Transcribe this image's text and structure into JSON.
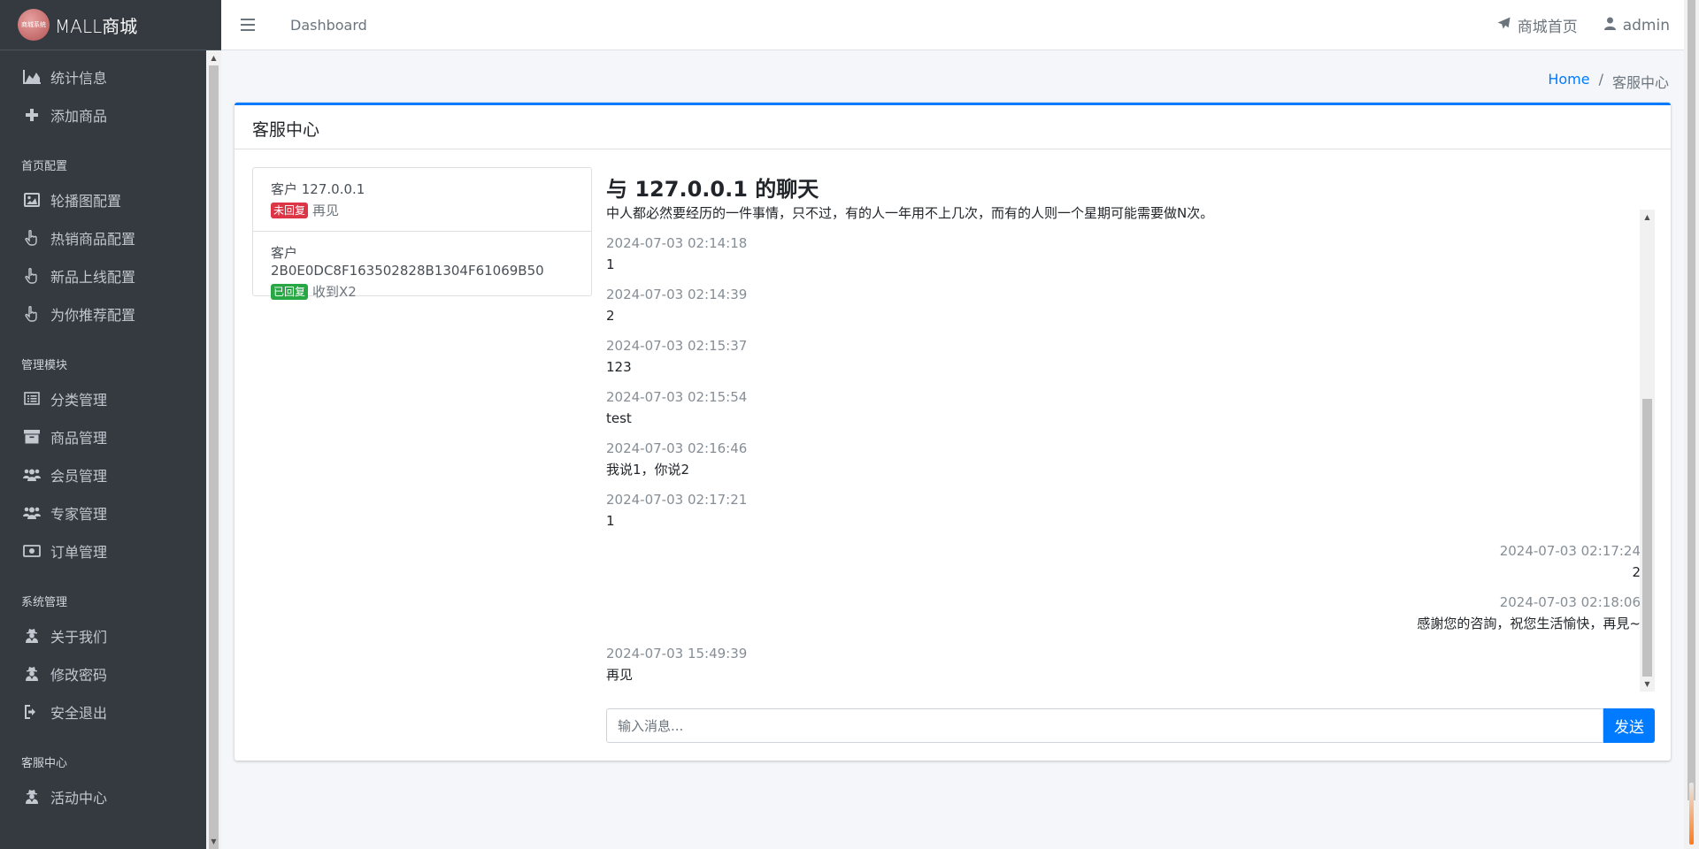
{
  "brand": {
    "logo_text": "商城系统",
    "name": "MALL商城"
  },
  "sidebar": {
    "top_items": [
      {
        "label": "统计信息",
        "icon": "area-chart-icon"
      },
      {
        "label": "添加商品",
        "icon": "plus-icon"
      }
    ],
    "sections": [
      {
        "header": "首页配置",
        "items": [
          {
            "label": "轮播图配置",
            "icon": "image-icon"
          },
          {
            "label": "热销商品配置",
            "icon": "hand-pointer-icon"
          },
          {
            "label": "新品上线配置",
            "icon": "hand-pointer-icon"
          },
          {
            "label": "为你推荐配置",
            "icon": "hand-pointer-icon"
          }
        ]
      },
      {
        "header": "管理模块",
        "items": [
          {
            "label": "分类管理",
            "icon": "list-alt-icon"
          },
          {
            "label": "商品管理",
            "icon": "archive-icon"
          },
          {
            "label": "会员管理",
            "icon": "users-icon"
          },
          {
            "label": "专家管理",
            "icon": "users-icon"
          },
          {
            "label": "订单管理",
            "icon": "money-bill-icon"
          }
        ]
      },
      {
        "header": "系统管理",
        "items": [
          {
            "label": "关于我们",
            "icon": "user-secret-icon"
          },
          {
            "label": "修改密码",
            "icon": "user-secret-icon"
          },
          {
            "label": "安全退出",
            "icon": "sign-out-icon"
          }
        ]
      },
      {
        "header": "客服中心",
        "items": [
          {
            "label": "活动中心",
            "icon": "user-secret-icon"
          }
        ]
      }
    ]
  },
  "topnav": {
    "dashboard": "Dashboard",
    "mall_home": "商城首页",
    "user": "admin"
  },
  "breadcrumb": {
    "home": "Home",
    "separator": "/",
    "current": "客服中心"
  },
  "card": {
    "title": "客服中心"
  },
  "clients": [
    {
      "name": "客户 127.0.0.1",
      "badge": "未回复",
      "badge_color": "#dc3545",
      "last_message": "再见"
    },
    {
      "name": "客户 2B0E0DC8F163502828B1304F61069B50",
      "badge": "已回复",
      "badge_color": "#28a745",
      "last_message": "收到X2"
    }
  ],
  "chat": {
    "title": "与 127.0.0.1 的聊天",
    "first_line": "中人都必然要经历的一件事情，只不过，有的人一年用不上几次，而有的人则一个星期可能需要做N次。",
    "messages": [
      {
        "time": "2024-07-03 02:14:18",
        "text": "1",
        "side": "left"
      },
      {
        "time": "2024-07-03 02:14:39",
        "text": "2",
        "side": "left"
      },
      {
        "time": "2024-07-03 02:15:37",
        "text": "123",
        "side": "left"
      },
      {
        "time": "2024-07-03 02:15:54",
        "text": "test",
        "side": "left"
      },
      {
        "time": "2024-07-03 02:16:46",
        "text": "我说1，你说2",
        "side": "left"
      },
      {
        "time": "2024-07-03 02:17:21",
        "text": "1",
        "side": "left"
      },
      {
        "time": "2024-07-03 02:17:24",
        "text": "2",
        "side": "right"
      },
      {
        "time": "2024-07-03 02:18:06",
        "text": "感謝您的咨詢，祝您生活愉快，再見~",
        "side": "right"
      },
      {
        "time": "2024-07-03 15:49:39",
        "text": "再见",
        "side": "left"
      }
    ],
    "input_placeholder": "输入消息...",
    "input_value": "",
    "send_label": "发送"
  }
}
